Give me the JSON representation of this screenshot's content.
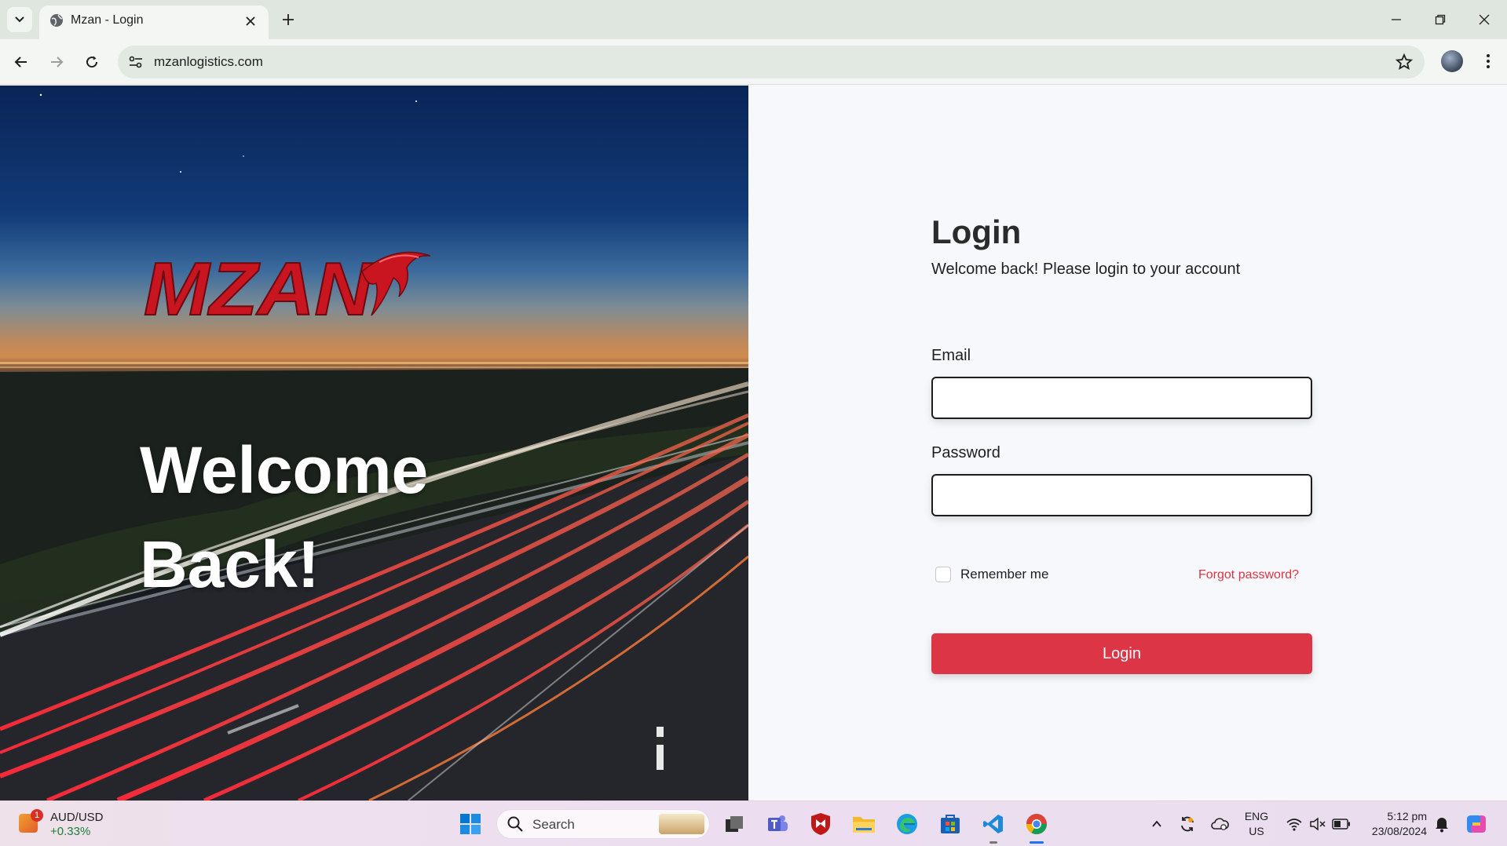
{
  "browser": {
    "tab_title": "Mzan - Login",
    "url": "mzanlogistics.com"
  },
  "hero": {
    "logo_text": "MZAN",
    "welcome_line1": "Welcome",
    "welcome_line2": "Back!"
  },
  "login": {
    "title": "Login",
    "subtitle": "Welcome back! Please login to your account",
    "email_label": "Email",
    "email_value": "",
    "password_label": "Password",
    "password_value": "",
    "remember_label": "Remember me",
    "remember_checked": false,
    "forgot_label": "Forgot password?",
    "submit_label": "Login"
  },
  "taskbar": {
    "widget_pair": "AUD/USD",
    "widget_change": "+0.33%",
    "widget_badge": "1",
    "search_label": "Search",
    "lang_line1": "ENG",
    "lang_line2": "US",
    "time": "5:12 pm",
    "date": "23/08/2024"
  },
  "colors": {
    "accent": "#dc3545",
    "panel_bg": "#f6f8fc"
  }
}
